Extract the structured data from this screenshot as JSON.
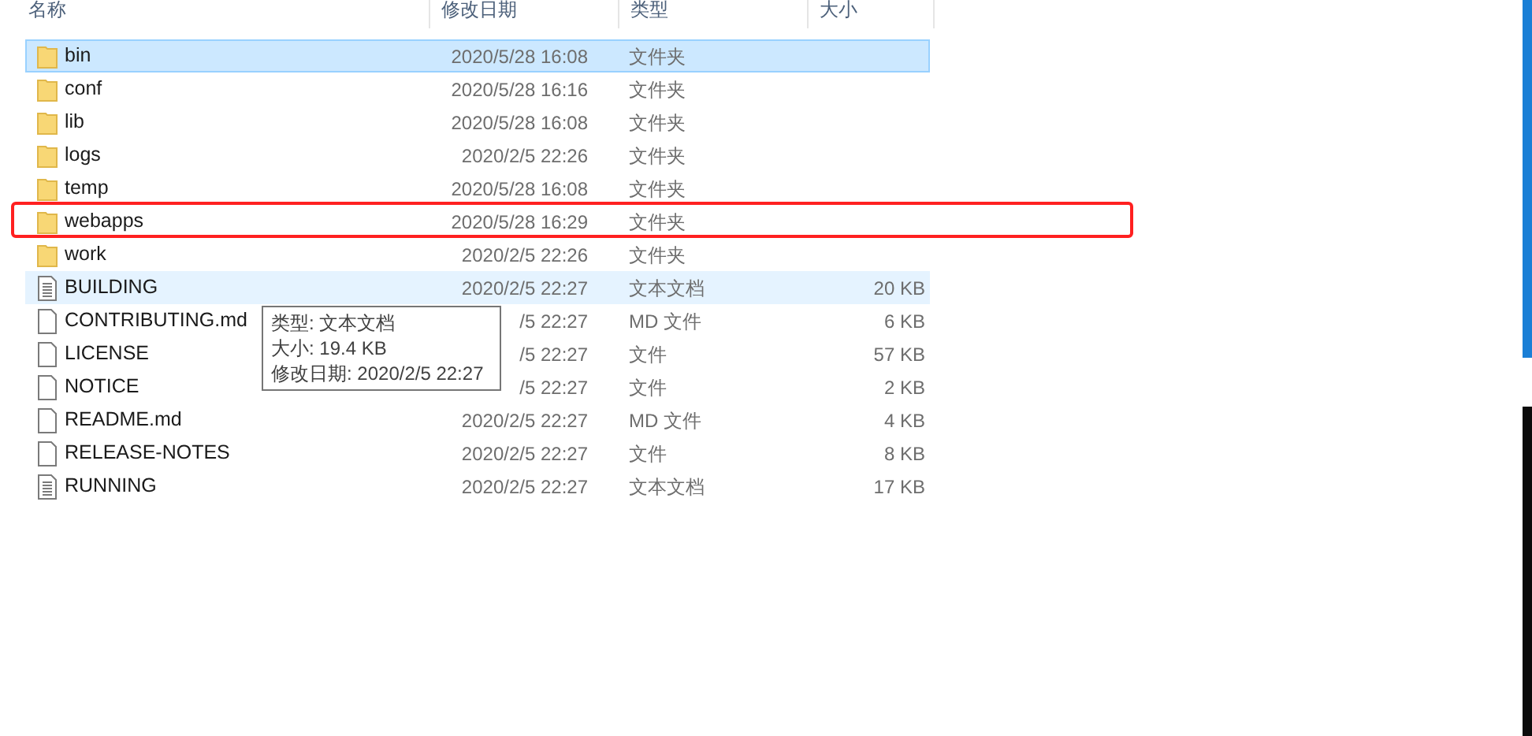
{
  "columns": [
    "名称",
    "修改日期",
    "类型",
    "大小"
  ],
  "rows": [
    {
      "name": "bin",
      "kind": "folder",
      "date": "2020/5/28 16:08",
      "type": "文件夹",
      "selected": true,
      "hovered": false,
      "highlighted": false
    },
    {
      "name": "conf",
      "kind": "folder",
      "date": "2020/5/28 16:16",
      "type": "文件夹",
      "selected": false,
      "hovered": false,
      "highlighted": false
    },
    {
      "name": "lib",
      "kind": "folder",
      "date": "2020/5/28 16:08",
      "type": "文件夹",
      "selected": false,
      "hovered": false,
      "highlighted": false
    },
    {
      "name": "logs",
      "kind": "folder",
      "date": "2020/2/5 22:26",
      "type": "文件夹",
      "selected": false,
      "hovered": false,
      "highlighted": false
    },
    {
      "name": "temp",
      "kind": "folder",
      "date": "2020/5/28 16:08",
      "type": "文件夹",
      "selected": false,
      "hovered": false,
      "highlighted": false
    },
    {
      "name": "webapps",
      "kind": "folder",
      "date": "2020/5/28 16:29",
      "type": "文件夹",
      "selected": false,
      "hovered": false,
      "highlighted": true
    },
    {
      "name": "work",
      "kind": "folder",
      "date": "2020/2/5 22:26",
      "type": "文件夹",
      "selected": false,
      "hovered": false,
      "highlighted": false
    },
    {
      "name": "BUILDING",
      "kind": "text",
      "date": "2020/2/5 22:27",
      "type": "文本文档",
      "size": "20 KB",
      "selected": false,
      "hovered": true,
      "highlighted": false
    },
    {
      "name": "CONTRIBUTING.md",
      "kind": "file",
      "date": "/5 22:27",
      "type": "MD 文件",
      "size": "6 KB",
      "selected": false,
      "hovered": false,
      "highlighted": false
    },
    {
      "name": "LICENSE",
      "kind": "file",
      "date": "/5 22:27",
      "type": "文件",
      "size": "57 KB",
      "selected": false,
      "hovered": false,
      "highlighted": false
    },
    {
      "name": "NOTICE",
      "kind": "file",
      "date": "/5 22:27",
      "type": "文件",
      "size": "2 KB",
      "selected": false,
      "hovered": false,
      "highlighted": false
    },
    {
      "name": "README.md",
      "kind": "file",
      "date": "2020/2/5 22:27",
      "type": "MD 文件",
      "size": "4 KB",
      "selected": false,
      "hovered": false,
      "highlighted": false
    },
    {
      "name": "RELEASE-NOTES",
      "kind": "file",
      "date": "2020/2/5 22:27",
      "type": "文件",
      "size": "8 KB",
      "selected": false,
      "hovered": false,
      "highlighted": false
    },
    {
      "name": "RUNNING",
      "kind": "text",
      "date": "2020/2/5 22:27",
      "type": "文本文档",
      "size": "17 KB",
      "selected": false,
      "hovered": false,
      "highlighted": false
    }
  ],
  "tooltip": [
    "类型: 文本文档",
    "大小: 19.4 KB",
    "修改日期: 2020/2/5 22:27"
  ]
}
